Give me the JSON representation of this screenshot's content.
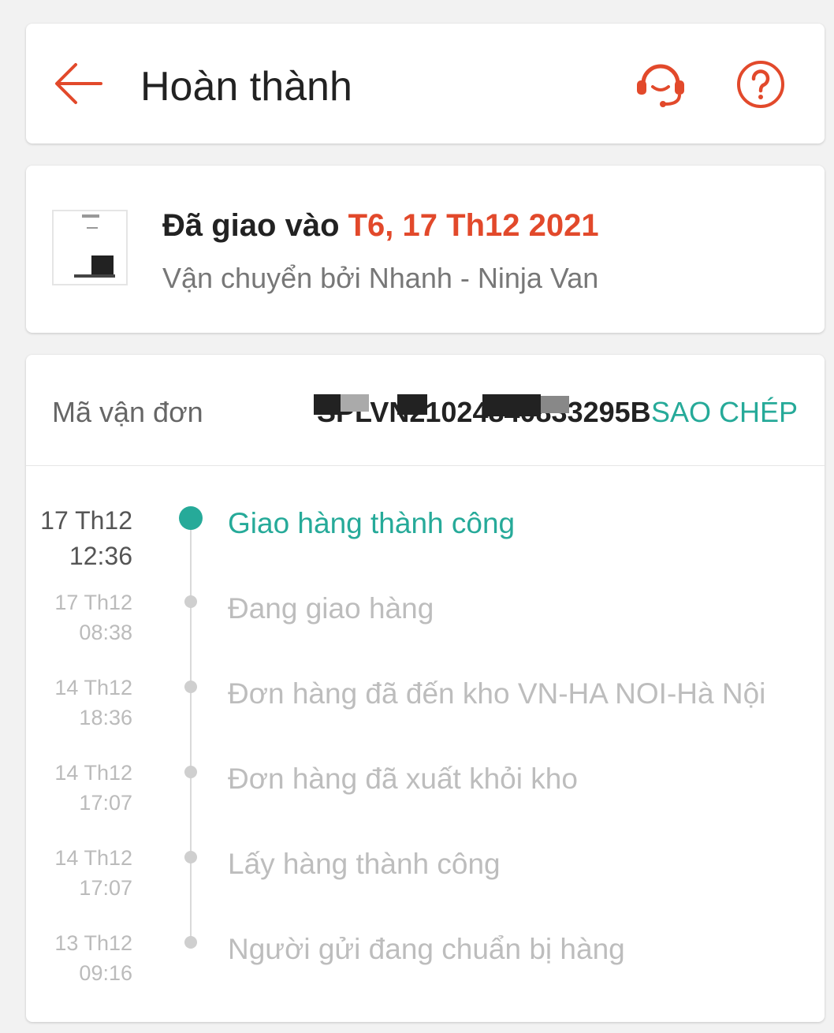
{
  "header": {
    "title": "Hoàn thành",
    "back_icon": "arrow-left-icon",
    "support_icon": "headset-icon",
    "help_icon": "question-circle-icon",
    "accent_color": "#e2492b"
  },
  "delivery": {
    "delivered_prefix": "Đã giao vào ",
    "delivered_date": "T6, 17 Th12 2021",
    "carrier": "Vận chuyển bởi Nhanh - Ninja Van"
  },
  "tracking": {
    "label": "Mã vận đơn",
    "number": "SPLVN21024840833295B",
    "copy_label": "SAO CHÉP",
    "copy_color": "#26aa99"
  },
  "events": [
    {
      "date": "17 Th12",
      "time": "12:36",
      "status": "Giao hàng thành công",
      "active": true
    },
    {
      "date": "17 Th12",
      "time": "08:38",
      "status": "Đang giao hàng",
      "active": false
    },
    {
      "date": "14 Th12",
      "time": "18:36",
      "status": "Đơn hàng đã đến kho VN-HA NOI-Hà Nội",
      "active": false
    },
    {
      "date": "14 Th12",
      "time": "17:07",
      "status": "Đơn hàng đã xuất khỏi kho",
      "active": false
    },
    {
      "date": "14 Th12",
      "time": "17:07",
      "status": "Lấy hàng thành công",
      "active": false
    },
    {
      "date": "13 Th12",
      "time": "09:16",
      "status": "Người gửi đang chuẩn bị hàng",
      "active": false
    }
  ]
}
